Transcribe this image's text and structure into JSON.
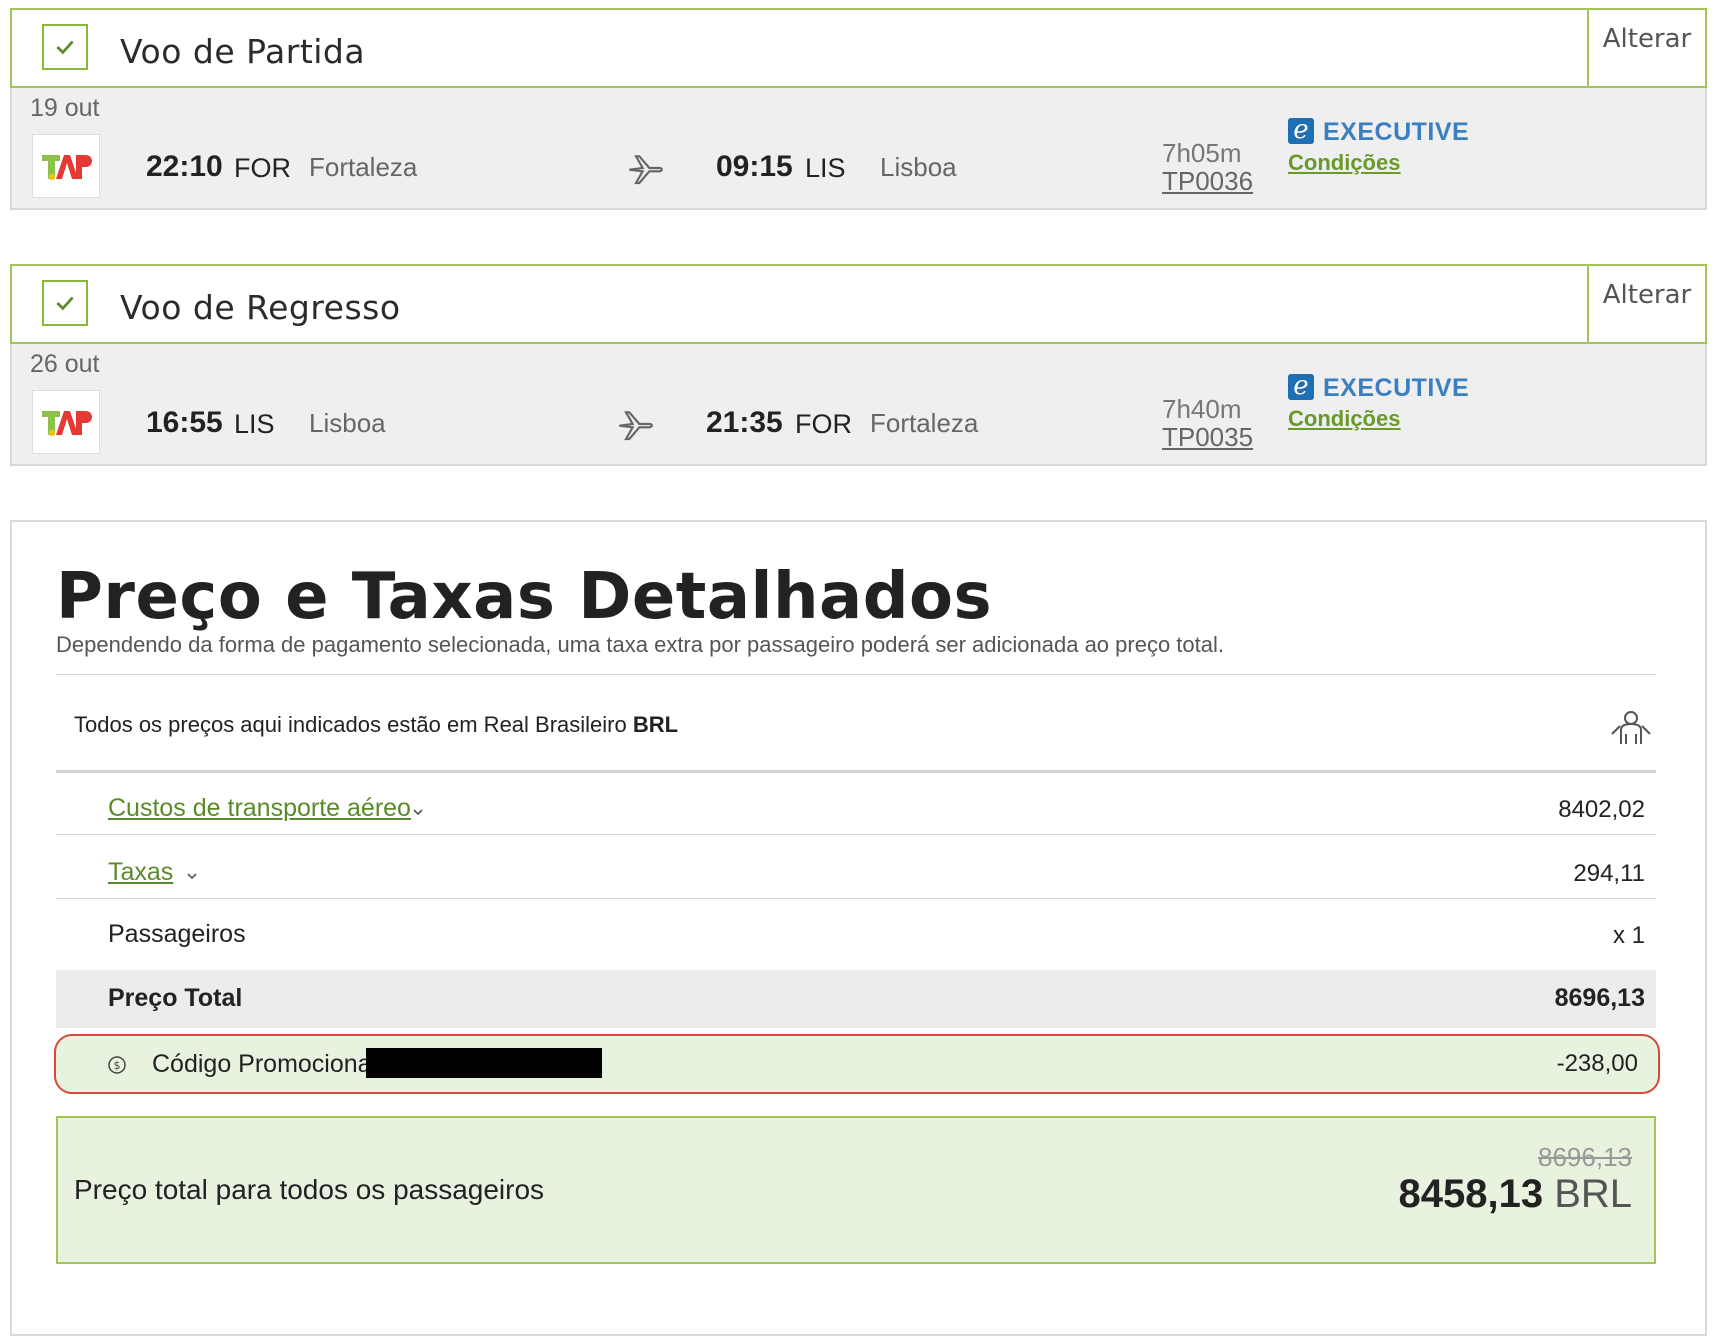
{
  "outbound": {
    "title": "Voo de Partida",
    "change_label": "Alterar",
    "date": "19 out",
    "dep_time": "22:10",
    "dep_code": "FOR",
    "dep_city": "Fortaleza",
    "arr_time": "09:15",
    "arr_code": "LIS",
    "arr_city": "Lisboa",
    "duration": "7h05m",
    "flight_number": "TP0036",
    "cabin": "EXECUTIVE",
    "conditions_label": "Condições"
  },
  "return": {
    "title": "Voo de Regresso",
    "change_label": "Alterar",
    "date": "26 out",
    "dep_time": "16:55",
    "dep_code": "LIS",
    "dep_city": "Lisboa",
    "arr_time": "21:35",
    "arr_code": "FOR",
    "arr_city": "Fortaleza",
    "duration": "7h40m",
    "flight_number": "TP0035",
    "cabin": "EXECUTIVE",
    "conditions_label": "Condições"
  },
  "pricing": {
    "title": "Preço e Taxas Detalhados",
    "subtitle": "Dependendo da forma de pagamento selecionada, uma taxa extra por passageiro poderá ser adicionada ao preço total.",
    "currency_note": "Todos os preços aqui indicados estão em Real Brasileiro",
    "currency_code": "BRL",
    "rows": [
      {
        "label": "Custos de transporte aéreo",
        "value": "8402,02"
      },
      {
        "label": "Taxas",
        "value": "294,11"
      },
      {
        "label": "Passageiros",
        "value": "x 1"
      }
    ],
    "total_label": "Preço Total",
    "total_value": "8696,13",
    "promo_label": "Código Promocional",
    "promo_value": "-238,00",
    "grand_label": "Preço total para todos os passageiros",
    "grand_old": "8696,13",
    "grand_new": "8458,13",
    "grand_currency": "BRL"
  },
  "colors": {
    "accent_green": "#a3c45a",
    "link_green": "#5a8a2a",
    "executive_blue": "#3a7fc1",
    "promo_border": "#d9483b",
    "highlight_bg": "#e7f2df"
  }
}
